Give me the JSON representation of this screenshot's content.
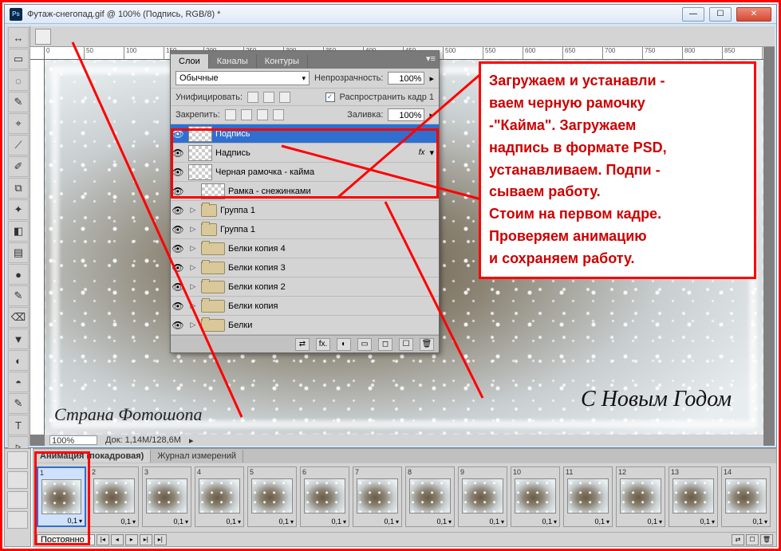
{
  "window": {
    "title": "Футаж-снегопад.gif @ 100% (Подпись, RGB/8) *",
    "min": "—",
    "max": "☐",
    "close": "✕"
  },
  "ruler_ticks": [
    "0",
    "50",
    "100",
    "150",
    "200",
    "250",
    "300",
    "350",
    "400",
    "450",
    "500",
    "550",
    "600",
    "650",
    "700",
    "750",
    "800",
    "850"
  ],
  "status": {
    "zoom": "100%",
    "doc": "Док: 1,14M/128,6M"
  },
  "canvas": {
    "watermark": "Страна Фотошопа",
    "greeting": "С Новым Годом"
  },
  "layers_panel": {
    "tabs": [
      "Слои",
      "Каналы",
      "Контуры"
    ],
    "active_tab": 0,
    "blend_label": "Обычные",
    "opacity_label": "Непрозрачность:",
    "opacity_value": "100%",
    "unify_label": "Унифицировать:",
    "propagate_label": "Распространить кадр 1",
    "lock_label": "Закрепить:",
    "fill_label": "Заливка:",
    "fill_value": "100%",
    "layers": [
      {
        "name": "Подпись",
        "thumb": "checker",
        "selected": true
      },
      {
        "name": "Надпись",
        "thumb": "checker",
        "fx": true
      },
      {
        "name": "Черная рамочка - кайма",
        "thumb": "checker"
      },
      {
        "name": "Рамка - снежинками",
        "thumb": "checker",
        "indent": 0
      },
      {
        "name": "Группа 1",
        "thumb": "folder",
        "group": true
      },
      {
        "name": "Группа 1",
        "thumb": "folder",
        "group": true,
        "indent": 1
      },
      {
        "name": "Белки  копия 4",
        "thumb": "folder",
        "group": true,
        "indent": 2
      },
      {
        "name": "Белки  копия 3",
        "thumb": "folder",
        "group": true,
        "indent": 2
      },
      {
        "name": "Белки  копия 2",
        "thumb": "folder",
        "group": true,
        "indent": 2
      },
      {
        "name": "Белки  копия",
        "thumb": "folder",
        "group": true,
        "indent": 2
      },
      {
        "name": "Белки",
        "thumb": "folder",
        "group": true,
        "indent": 2
      }
    ],
    "footer_icons": [
      "⇄",
      "fx.",
      "◐",
      "▭",
      "◻",
      "☐",
      "🗑"
    ]
  },
  "annotation": {
    "lines": [
      "Загружаем и устанавли -",
      "ваем черную рамочку",
      "-\"Кайма\". Загружаем",
      "надпись в формате PSD,",
      "устанавливаем. Подпи -",
      "сываем работу.",
      "Стоим на первом кадре.",
      "Проверяем анимацию",
      "и сохраняем работу."
    ]
  },
  "animation": {
    "tabs": [
      "Анимация (покадровая)",
      "Журнал измерений"
    ],
    "active_tab": 0,
    "loop_label": "Постоянно",
    "frame_count": 14,
    "selected_frame": 1,
    "frame_time": "0,1"
  },
  "tools": [
    "↔",
    "▭",
    "◌",
    "✎",
    "⌖",
    "⟋",
    "✐",
    "⧉",
    "✦",
    "◧",
    "▤",
    "●",
    "✎",
    "⌫",
    "▼",
    "◐",
    "◓",
    "✎",
    "T",
    "▹",
    "◻",
    "✋",
    "🔍"
  ]
}
